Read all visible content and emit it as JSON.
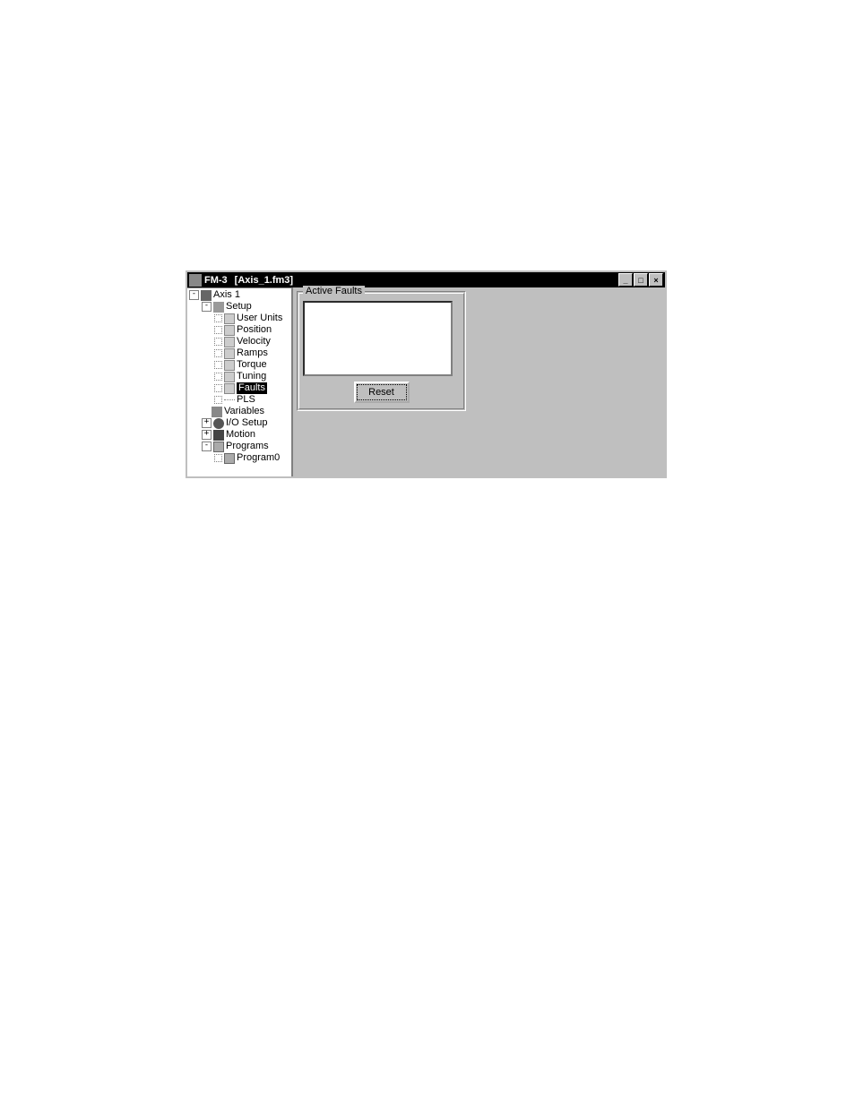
{
  "window": {
    "app_name": "FM-3",
    "document": "[Axis_1.fm3]"
  },
  "tree": {
    "root": "Axis 1",
    "setup": "Setup",
    "setup_children": [
      "User Units",
      "Position",
      "Velocity",
      "Ramps",
      "Torque",
      "Tuning",
      "Faults",
      "PLS"
    ],
    "selected_index": 6,
    "variables": "Variables",
    "io_setup": "I/O Setup",
    "motion": "Motion",
    "programs": "Programs",
    "program0": "Program0"
  },
  "panel": {
    "group_title": "Active Faults",
    "reset_label": "Reset"
  }
}
